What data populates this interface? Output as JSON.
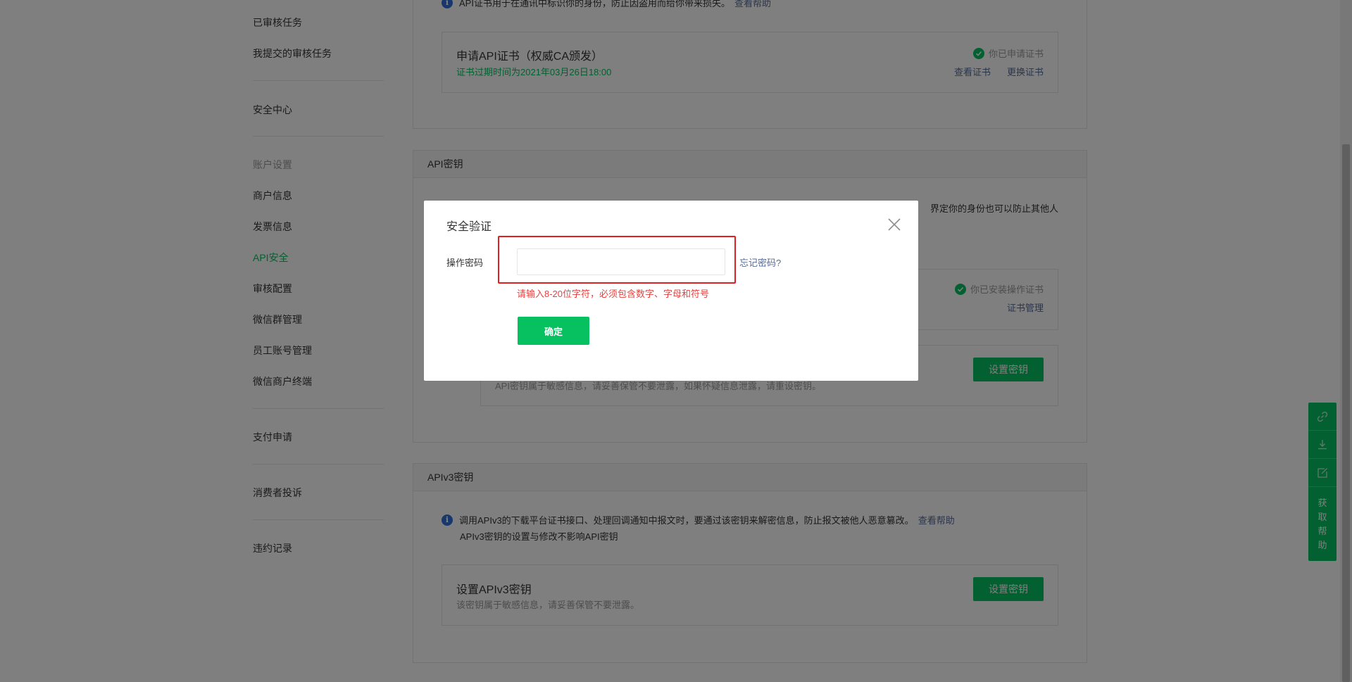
{
  "sidebar": {
    "items": [
      {
        "label": "已审核任务"
      },
      {
        "label": "我提交的审核任务"
      },
      {
        "label": "安全中心"
      },
      {
        "label": "账户设置"
      },
      {
        "label": "商户信息"
      },
      {
        "label": "发票信息"
      },
      {
        "label": "API安全"
      },
      {
        "label": "审核配置"
      },
      {
        "label": "微信群管理"
      },
      {
        "label": "员工账号管理"
      },
      {
        "label": "微信商户终端"
      },
      {
        "label": "支付申请"
      },
      {
        "label": "消费者投诉"
      },
      {
        "label": "违约记录"
      }
    ]
  },
  "api_cert_panel": {
    "info_text": "API证书用于在通讯中标识你的身份，防止因盗用而给你带来损失。",
    "help_link": "查看帮助",
    "cert_box": {
      "title": "申请API证书（权威CA颁发）",
      "expiry": "证书过期时间为2021年03月26日18:00",
      "status": "你已申请证书",
      "view_link": "查看证书",
      "replace_link": "更换证书"
    }
  },
  "api_key_panel": {
    "title": "API密钥",
    "info_tail": "界定你的身份也可以防止其他人",
    "op_box": {
      "status": "你已安装操作证书",
      "manage_link": "证书管理"
    },
    "key_box": {
      "desc": "API密钥属于敏感信息，请妥善保管不要泄露，如果怀疑信息泄露，请重设密钥。",
      "button": "设置密钥"
    }
  },
  "apiv3_panel": {
    "title": "APIv3密钥",
    "info_line1": "调用APIv3的下载平台证书接口、处理回调通知中报文时，要通过该密钥来解密信息，防止报文被他人恶意篡改。",
    "help_link": "查看帮助",
    "info_line2": "APIv3密钥的设置与修改不影响API密钥",
    "box": {
      "title": "设置APIv3密钥",
      "desc": "该密钥属于敏感信息，请妥善保管不要泄露。",
      "button": "设置密钥"
    }
  },
  "dialog": {
    "title": "安全验证",
    "field_label": "操作密码",
    "input_value": "",
    "forgot_link": "忘记密码?",
    "error_text": "请输入8-20位字符，必须包含数字、字母和符号",
    "confirm_button": "确定"
  },
  "float_bar": {
    "icons": [
      "link-icon",
      "download-icon",
      "edit-icon"
    ],
    "help_label": "获取帮助"
  },
  "colors": {
    "accent_green": "#07c160",
    "link_blue": "#576b95",
    "error_red": "#e64340",
    "highlight_red": "#e02020"
  }
}
